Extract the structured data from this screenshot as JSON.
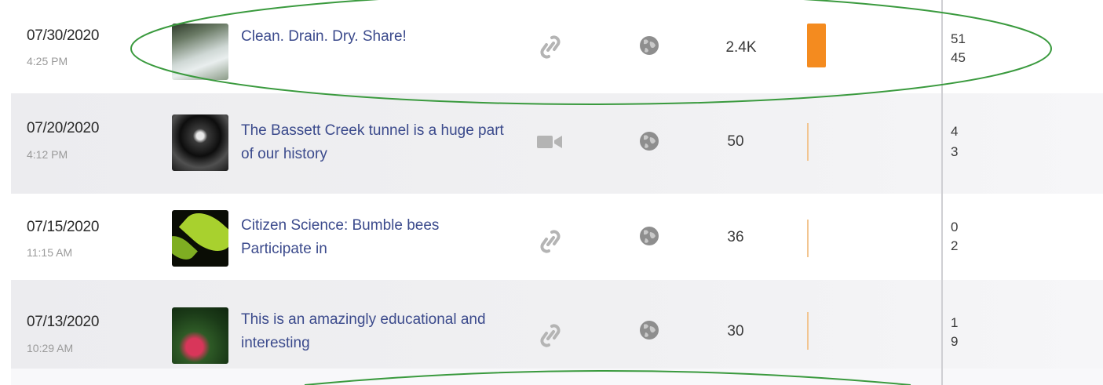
{
  "posts": [
    {
      "date": "07/30/2020",
      "time": "4:25 PM",
      "thumbnail": "river-thumbnail",
      "title": "Clean. Drain. Dry. Share!",
      "type_icon": "link-icon",
      "audience_icon": "globe-icon",
      "reach": "2.4K",
      "reach_bar_fraction": 1.0,
      "engagement_top": "51",
      "engagement_bottom": "45"
    },
    {
      "date": "07/20/2020",
      "time": "4:12 PM",
      "thumbnail": "tunnel-thumbnail",
      "title": "The Bassett Creek tunnel is a huge part of our history",
      "type_icon": "video-icon",
      "audience_icon": "globe-icon",
      "reach": "50",
      "reach_bar_fraction": 0.02,
      "engagement_top": "4",
      "engagement_bottom": "3"
    },
    {
      "date": "07/15/2020",
      "time": "11:15 AM",
      "thumbnail": "leaf-thumbnail",
      "title": "Citizen Science: Bumble bees Participate in",
      "type_icon": "link-icon",
      "audience_icon": "globe-icon",
      "reach": "36",
      "reach_bar_fraction": 0.015,
      "engagement_top": "0",
      "engagement_bottom": "2"
    },
    {
      "date": "07/13/2020",
      "time": "10:29 AM",
      "thumbnail": "flower-thumbnail",
      "title": "This is an amazingly educational and interesting",
      "type_icon": "link-icon",
      "audience_icon": "globe-icon",
      "reach": "30",
      "reach_bar_fraction": 0.0125,
      "engagement_top": "1",
      "engagement_bottom": "9"
    }
  ],
  "colors": {
    "title_link": "#3b4a8c",
    "reach_bar": "#f48b1f",
    "highlight": "#3a9a3e"
  }
}
